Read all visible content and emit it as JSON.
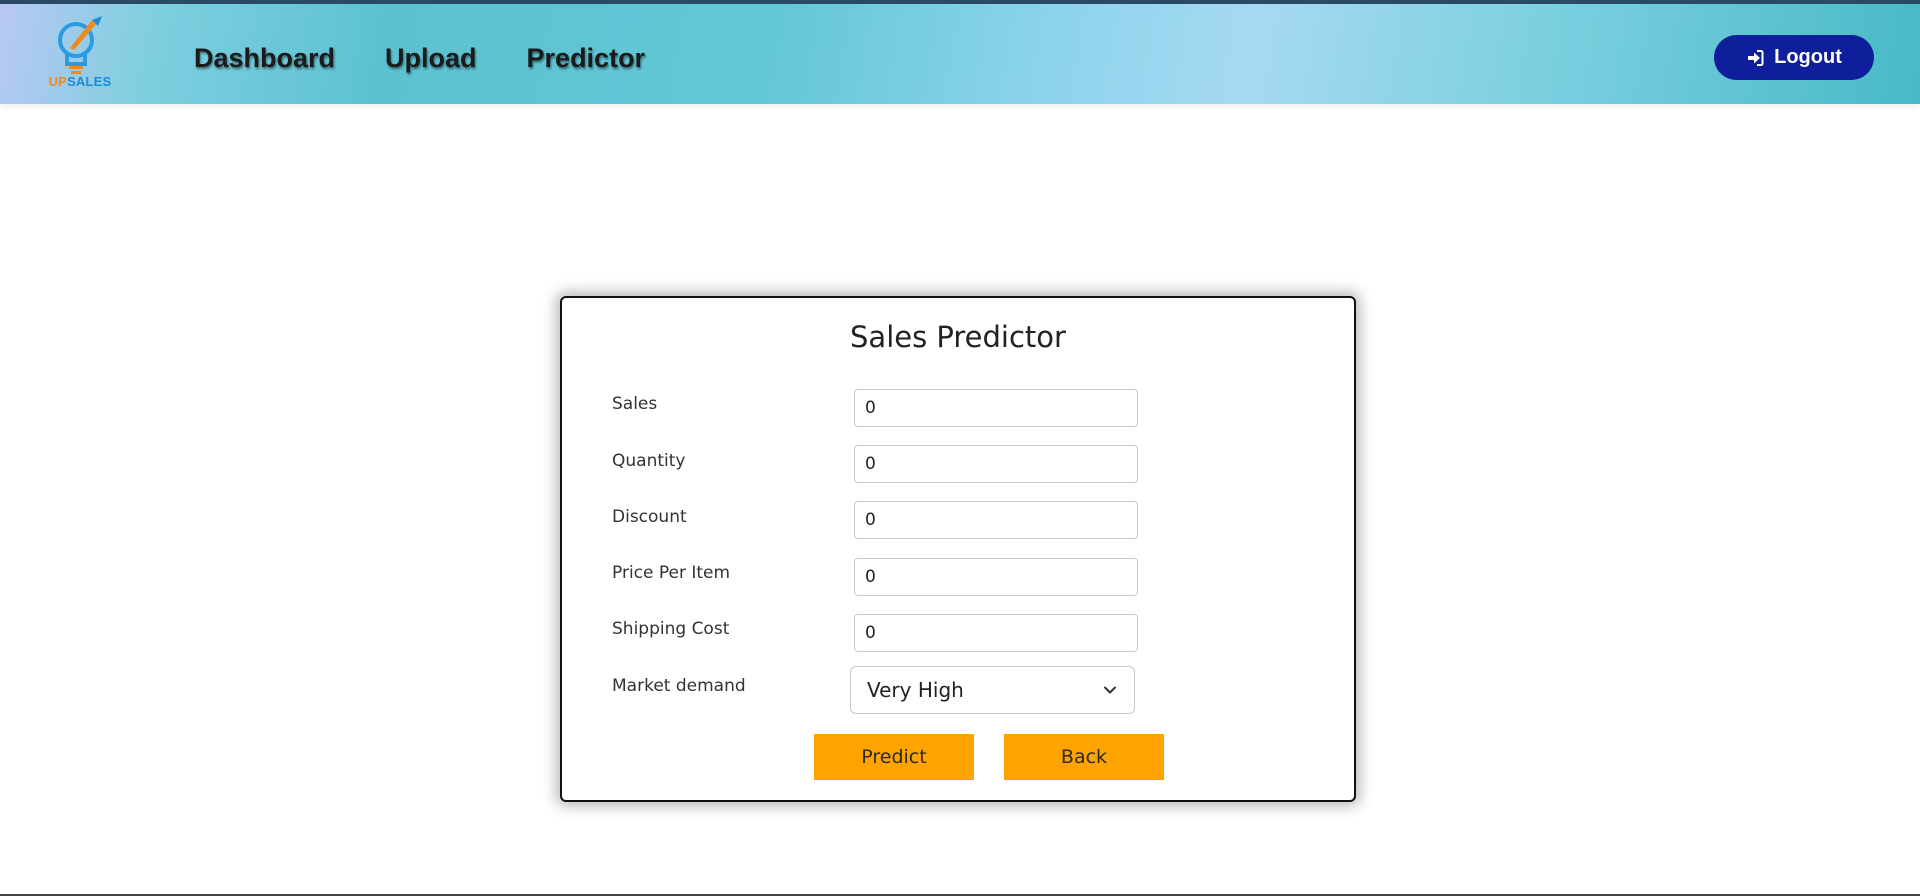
{
  "brand": {
    "logo_up": "UP",
    "logo_sales": "SALES"
  },
  "nav": {
    "dashboard": "Dashboard",
    "upload": "Upload",
    "predictor": "Predictor"
  },
  "header": {
    "logout_label": "Logout",
    "logout_icon": "sign-in-icon"
  },
  "form": {
    "title": "Sales Predictor",
    "fields": [
      {
        "label": "Sales",
        "value": "0"
      },
      {
        "label": "Quantity",
        "value": "0"
      },
      {
        "label": "Discount",
        "value": "0"
      },
      {
        "label": "Price Per Item",
        "value": "0"
      },
      {
        "label": "Shipping Cost",
        "value": "0"
      }
    ],
    "market_demand": {
      "label": "Market demand",
      "selected": "Very High"
    },
    "predict_label": "Predict",
    "back_label": "Back"
  },
  "colors": {
    "accent_button": "#ffa300",
    "logout_bg": "#0f1f9c"
  }
}
